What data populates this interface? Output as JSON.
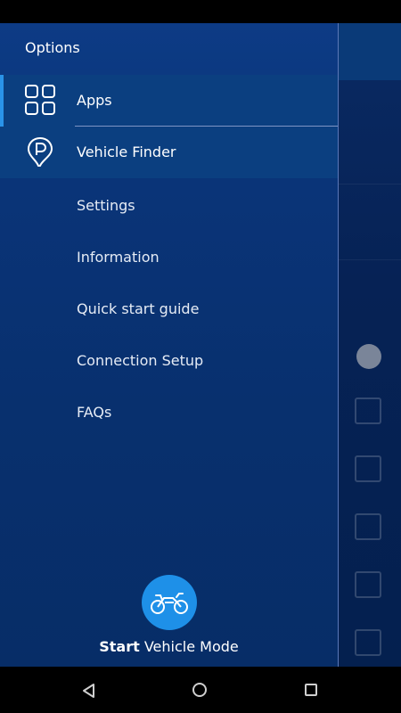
{
  "drawer": {
    "title": "Options",
    "primary_items": [
      {
        "label": "Apps",
        "icon": "apps-grid-icon"
      },
      {
        "label": "Vehicle Finder",
        "icon": "parking-pin-icon"
      }
    ],
    "secondary_items": [
      {
        "label": "Settings"
      },
      {
        "label": "Information"
      },
      {
        "label": "Quick start guide"
      },
      {
        "label": "Connection Setup"
      },
      {
        "label": "FAQs"
      }
    ],
    "start": {
      "icon": "motorcycle-icon",
      "label_bold": "Start",
      "label_rest": "Vehicle Mode"
    }
  },
  "colors": {
    "drawer_bg": "#0a3478",
    "selected_bg": "#0b3f80",
    "accent": "#2a93e8",
    "start_button": "#1e90e8"
  },
  "navbar": {
    "back_icon": "back-triangle-icon",
    "home_icon": "home-circle-icon",
    "recent_icon": "recent-square-icon"
  }
}
